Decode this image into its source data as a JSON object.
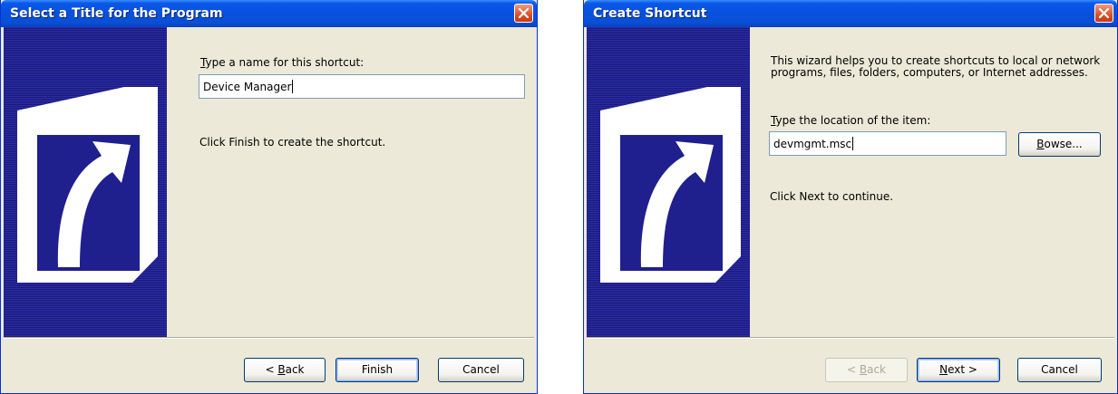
{
  "dialog_select_title": {
    "title": "Select a Title for the Program",
    "name_label_prefix": "T",
    "name_label_rest": "ype a name for this shortcut:",
    "name_value": "Device Manager",
    "finish_hint": "Click Finish to create the shortcut.",
    "back_label_prefix": "< ",
    "back_label_accel": "B",
    "back_label_rest": "ack",
    "finish_label": "Finish",
    "cancel_label": "Cancel",
    "icons": {
      "close": "close-icon",
      "banner": "shortcut-arrow-icon"
    }
  },
  "dialog_create_shortcut": {
    "title": "Create Shortcut",
    "intro": "This wizard helps you to create shortcuts to local or network programs, files, folders, computers, or Internet addresses.",
    "location_label_prefix": "T",
    "location_label_rest": "ype the location of the item:",
    "location_value": "devmgmt.msc",
    "browse_label_prefix": "B",
    "browse_label_accel": "r",
    "browse_label_rest": "owse...",
    "next_hint": "Click Next to continue.",
    "back_label_prefix": "< ",
    "back_label_accel": "B",
    "back_label_rest": "ack",
    "next_label_accel": "N",
    "next_label_rest": "ext >",
    "cancel_label": "Cancel",
    "back_disabled": true,
    "icons": {
      "close": "close-icon",
      "banner": "shortcut-arrow-icon"
    }
  },
  "colors": {
    "titlebar": "#0a58e8",
    "dialog_face": "#ece9d8",
    "banner_stripe_light": "#2c2ea8",
    "banner_stripe_dark": "#1a1878",
    "close_button": "#d9522a",
    "disabled_text": "#aca899"
  }
}
